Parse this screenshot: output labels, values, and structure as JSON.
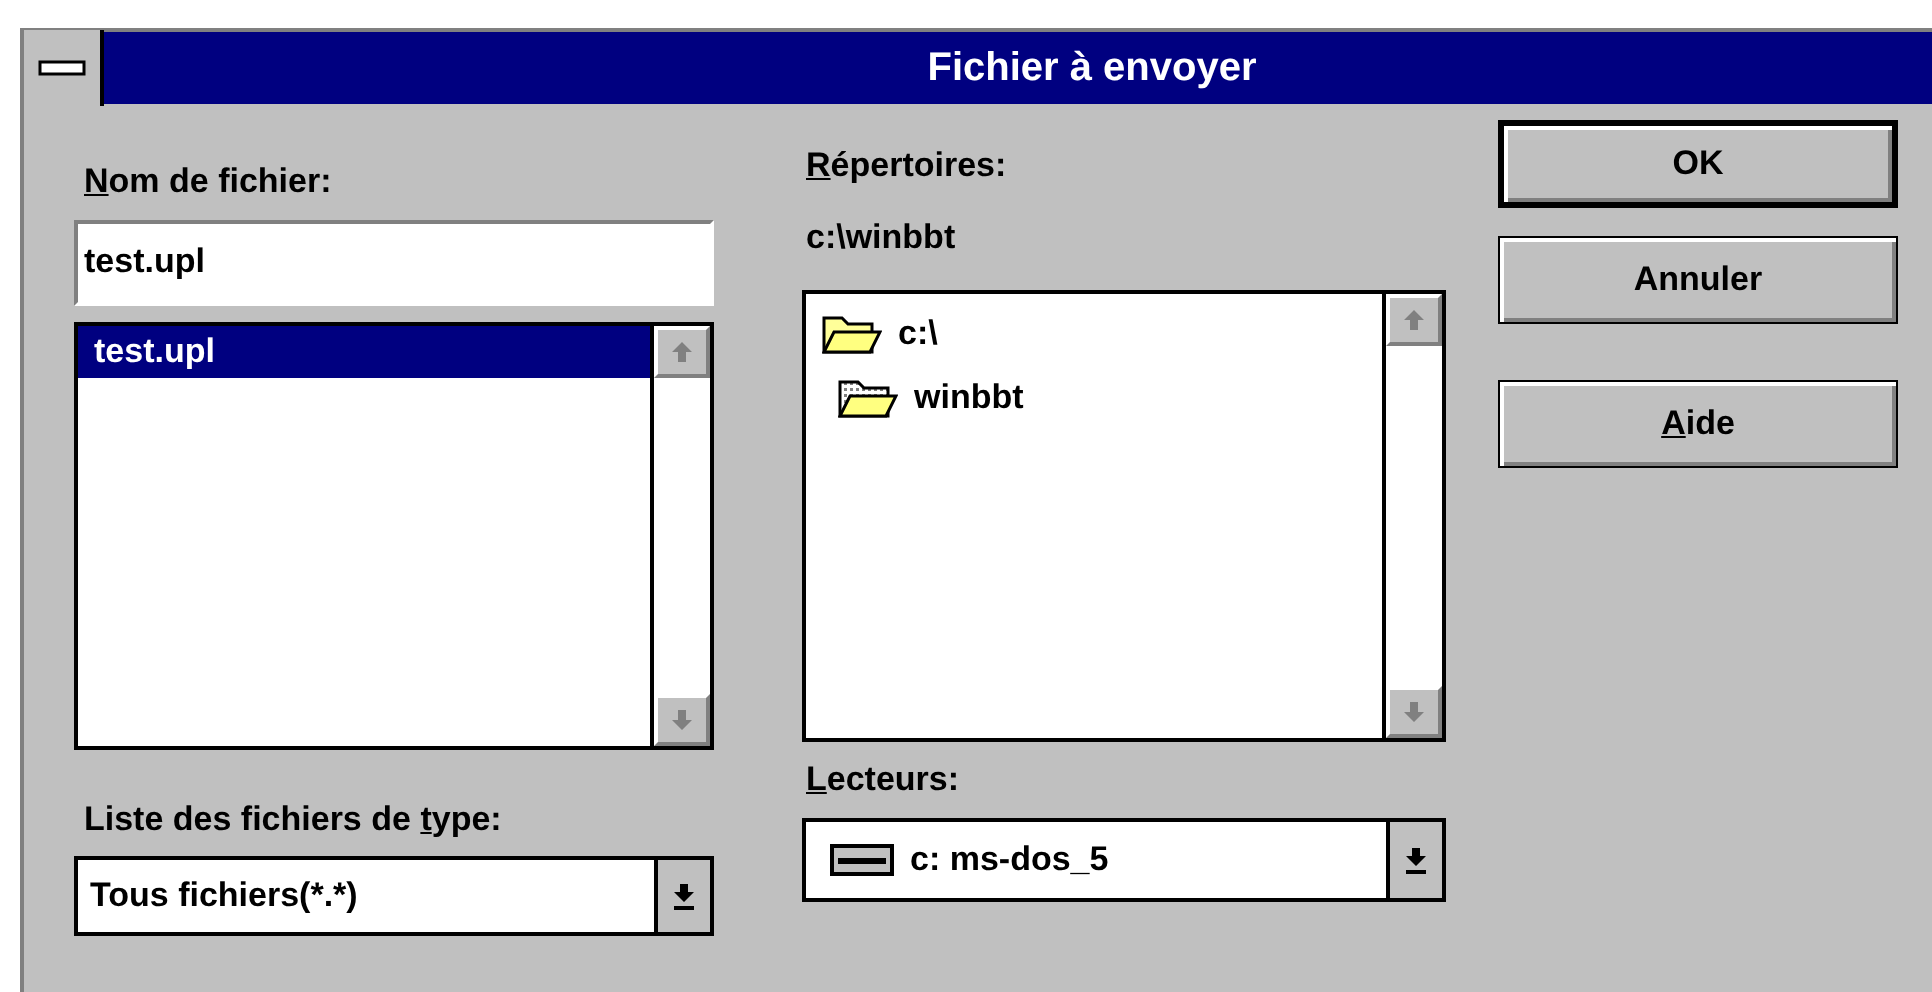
{
  "window": {
    "title": "Fichier à envoyer"
  },
  "file_name": {
    "label": "Nom de fichier:",
    "value": "test.upl",
    "files": [
      {
        "name": "test.upl",
        "selected": true
      }
    ]
  },
  "file_type": {
    "label": "Liste des fichiers de type:",
    "value": "Tous fichiers(*.*)"
  },
  "directories": {
    "label": "Répertoires:",
    "current": "c:\\winbbt",
    "items": [
      {
        "name": "c:\\",
        "kind": "open",
        "children": [
          {
            "name": "winbbt",
            "kind": "current"
          }
        ]
      }
    ]
  },
  "drives": {
    "label": "Lecteurs:",
    "value": "c: ms-dos_5"
  },
  "buttons": [
    {
      "label": "OK",
      "default": true
    },
    {
      "label": "Annuler",
      "default": false
    },
    {
      "label": "Aide",
      "default": false
    }
  ]
}
